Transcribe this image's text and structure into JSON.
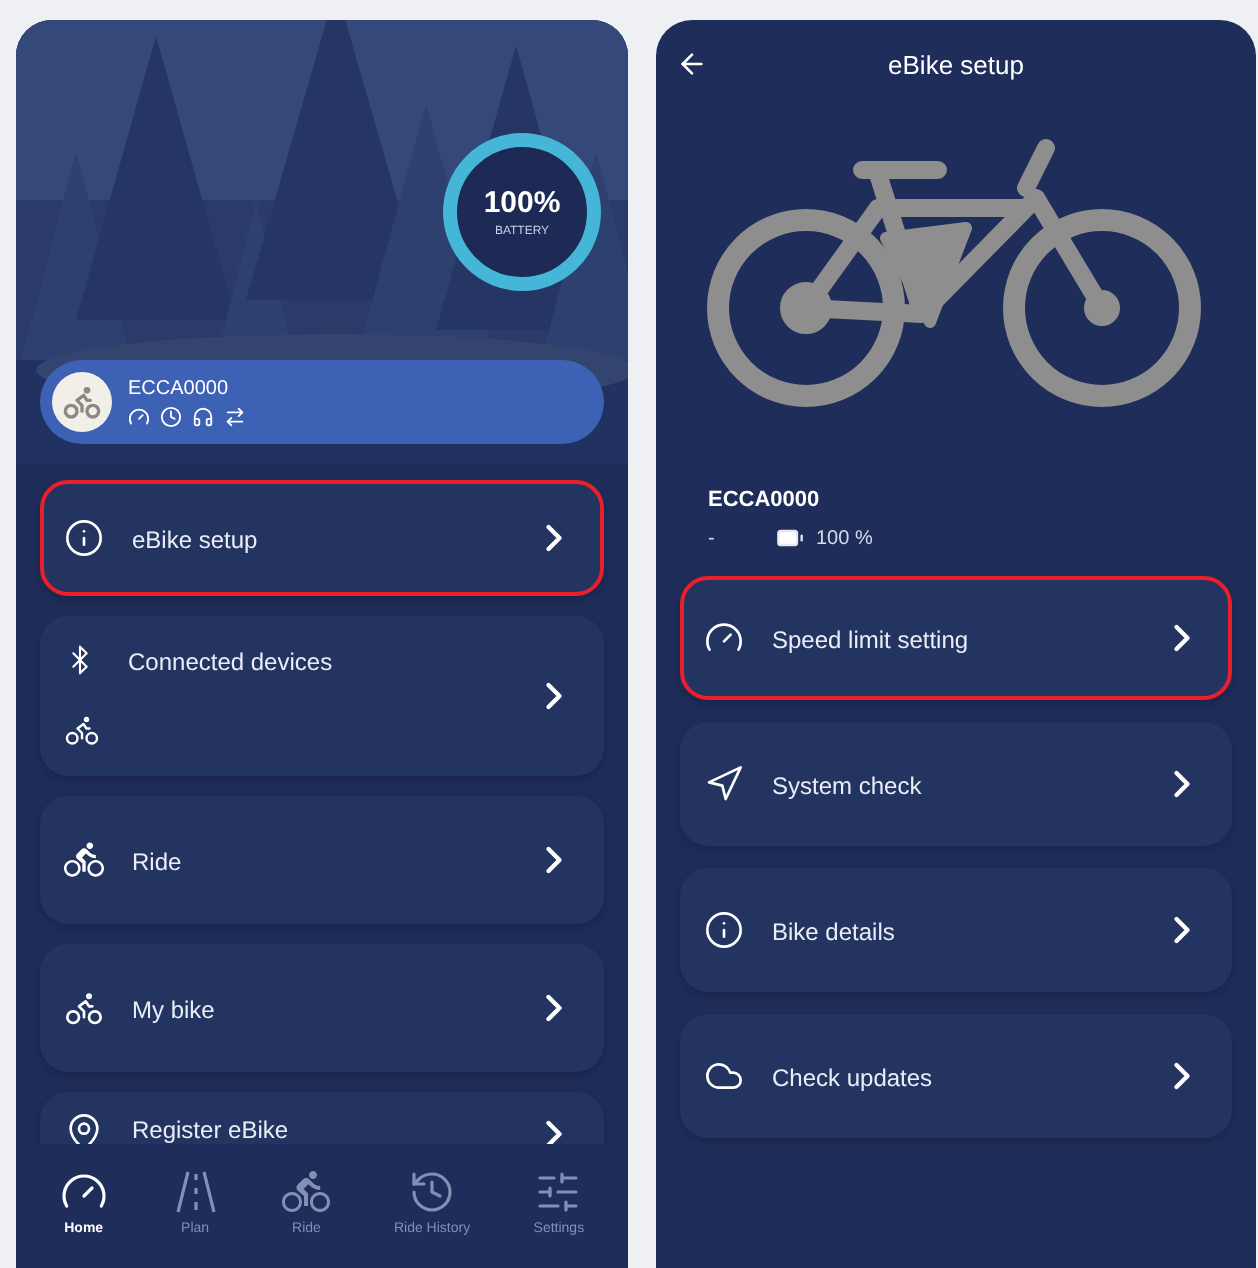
{
  "home": {
    "battery": {
      "value": "100%",
      "label": "BATTERY",
      "level": 1
    },
    "bike_card": {
      "name": "ECCA0000"
    },
    "menu": [
      {
        "kind": "info",
        "label": "eBike setup",
        "highlighted": true
      },
      {
        "kind": "devices",
        "label": "Connected devices",
        "highlighted": false
      },
      {
        "kind": "ride",
        "label": "Ride",
        "highlighted": false
      },
      {
        "kind": "bike",
        "label": "My bike",
        "highlighted": false
      },
      {
        "kind": "register",
        "label": "Register eBike",
        "highlighted": false
      }
    ],
    "tabs": [
      {
        "kind": "gauge",
        "label": "Home",
        "selected": true
      },
      {
        "kind": "road",
        "label": "Plan",
        "selected": false
      },
      {
        "kind": "ride",
        "label": "Ride",
        "selected": false
      },
      {
        "kind": "history",
        "label": "Ride History",
        "selected": false
      },
      {
        "kind": "sliders",
        "label": "Settings",
        "selected": false
      }
    ]
  },
  "setup": {
    "title": "eBike setup",
    "bike": {
      "name": "ECCA0000",
      "status": "-",
      "battery": "100 %"
    },
    "menu": [
      {
        "kind": "gauge",
        "label": "Speed limit setting",
        "highlighted": true
      },
      {
        "kind": "navigation",
        "label": "System check",
        "highlighted": false
      },
      {
        "kind": "info",
        "label": "Bike details",
        "highlighted": false
      },
      {
        "kind": "cloud",
        "label": "Check updates",
        "highlighted": false
      }
    ]
  }
}
